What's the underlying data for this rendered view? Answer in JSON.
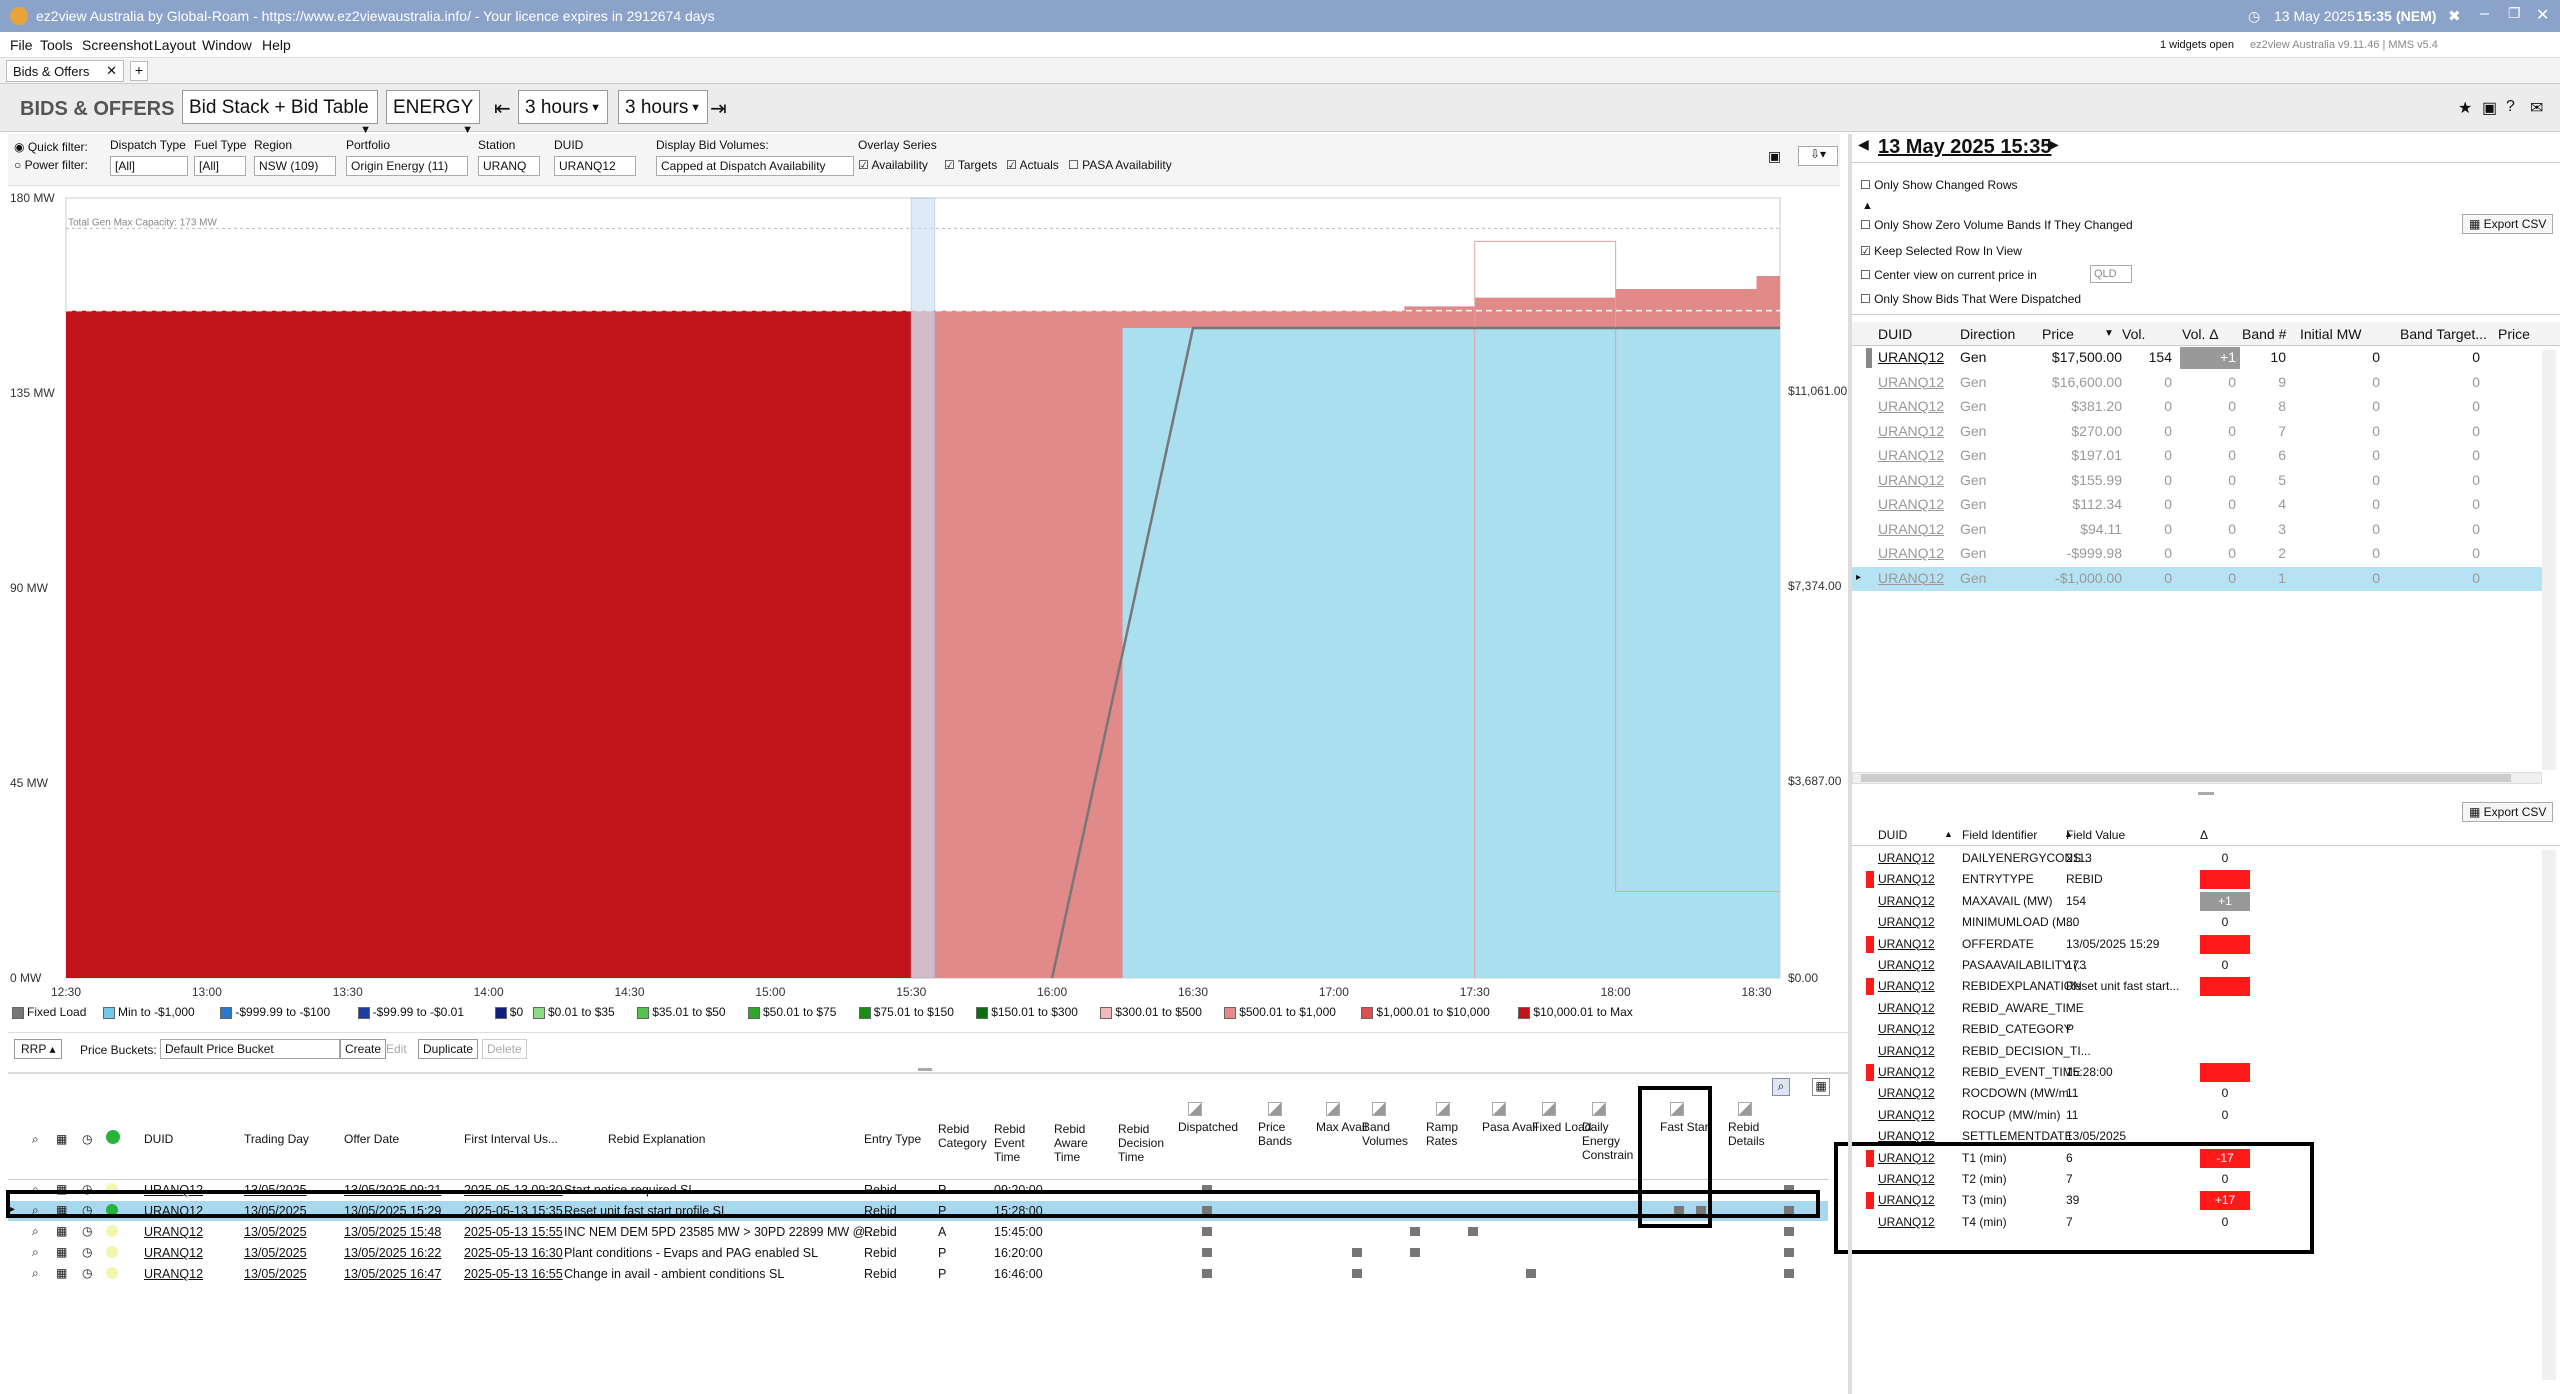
{
  "window": {
    "title": "ez2view Australia by Global-Roam - https://www.ez2viewaustralia.info/ - Your licence expires in 2912674 days",
    "datetime": "13 May 2025",
    "time": "15:35",
    "tz": "(NEM)"
  },
  "menu": [
    "File",
    "Tools",
    "Screenshot",
    "Layout",
    "Window",
    "Help"
  ],
  "menu_right": {
    "widgets": "1 widgets open",
    "version": "ez2view Australia v9.11.46 | MMS v5.4"
  },
  "tab": {
    "label": "Bids & Offers"
  },
  "header": {
    "title": "BIDS & OFFERS",
    "view": "Bid Stack + Bid Table",
    "market": "ENERGY",
    "back": "3 hours",
    "fwd": "3 hours"
  },
  "filters": {
    "quick": "Quick filter:",
    "power": "Power filter:",
    "dispatch_type_label": "Dispatch Type",
    "dispatch_type": "[All]",
    "fuel_type_label": "Fuel Type",
    "fuel_type": "[All]",
    "region_label": "Region",
    "region": "NSW (109)",
    "portfolio_label": "Portfolio",
    "portfolio": "Origin Energy (11)",
    "station_label": "Station",
    "station": "URANQ",
    "duid_label": "DUID",
    "duid": "URANQ12",
    "display_label": "Display Bid Volumes:",
    "display": "Capped at Dispatch Availability",
    "overlay_label": "Overlay Series",
    "availability": "Availability",
    "targets": "Targets",
    "actuals": "Actuals",
    "pasa": "PASA Availability"
  },
  "chart_data": {
    "type": "area",
    "title": "",
    "xlabel": "",
    "ylabel": "",
    "ylim": [
      0,
      180
    ],
    "y_ticks": [
      "0 MW",
      "45 MW",
      "90 MW",
      "135 MW",
      "180 MW"
    ],
    "x_ticks": [
      "12:30",
      "13:00",
      "13:30",
      "14:00",
      "14:30",
      "15:00",
      "15:30",
      "16:00",
      "16:30",
      "17:00",
      "17:30",
      "18:00",
      "18:30"
    ],
    "y2_ticks": [
      "$0.00",
      "$3,687.00",
      "$7,374.00",
      "$11,061.00"
    ],
    "annotation": "Total Gen Max Capacity: 173 MW",
    "series": [
      {
        "name": "$10,000.01 to Max",
        "color": "#c0141a",
        "x": [
          "12:30",
          "15:30"
        ],
        "values": [
          154,
          154
        ]
      },
      {
        "name": "$500.01 to $1,000",
        "color": "#e08a8a",
        "x": [
          "15:30",
          "18:35"
        ],
        "values": [
          154,
          162
        ]
      },
      {
        "name": "Min to -$1,000",
        "color": "#aadff0",
        "x": [
          "16:15",
          "18:35"
        ],
        "values": [
          150,
          150
        ]
      }
    ],
    "target_line": {
      "x": [
        "16:00",
        "16:30",
        "18:35"
      ],
      "values": [
        0,
        150,
        150
      ]
    }
  },
  "legend": [
    {
      "label": "Fixed Load",
      "color": "#777777"
    },
    {
      "label": "Min to -$1,000",
      "color": "#74c7e8"
    },
    {
      "label": "-$999.99 to -$100",
      "color": "#2a78c8"
    },
    {
      "label": "-$99.99 to -$0.01",
      "color": "#1b3fa0"
    },
    {
      "label": "$0",
      "color": "#10207a"
    },
    {
      "label": "$0.01 to $35",
      "color": "#8fd88a"
    },
    {
      "label": "$35.01 to $50",
      "color": "#56c24e"
    },
    {
      "label": "$50.01 to $75",
      "color": "#2fa82a"
    },
    {
      "label": "$75.01 to $150",
      "color": "#1a8c18"
    },
    {
      "label": "$150.01 to $300",
      "color": "#0e6d0e"
    },
    {
      "label": "$300.01 to $500",
      "color": "#f3b8b8"
    },
    {
      "label": "$500.01 to $1,000",
      "color": "#e58b8b"
    },
    {
      "label": "$1,000.01 to $10,000",
      "color": "#d95050"
    },
    {
      "label": "$10,000.01 to Max",
      "color": "#c0141a"
    }
  ],
  "chart_toolbar": {
    "rrp": "RRP",
    "buckets_label": "Price Buckets:",
    "bucket": "Default Price Bucket",
    "create": "Create",
    "edit": "Edit",
    "duplicate": "Duplicate",
    "delete": "Delete"
  },
  "bottom_table": {
    "headers": [
      "DUID",
      "Trading Day",
      "Offer Date",
      "First Interval Us...",
      "Rebid Explanation",
      "Entry Type",
      "Rebid Category",
      "Rebid Event Time",
      "Rebid Aware Time",
      "Rebid Decision Time",
      "Dispatched",
      "Price Bands",
      "Max Avail",
      "Band Volumes",
      "Ramp Rates",
      "Pasa Avail",
      "Fixed Load",
      "Daily Energy Constrain",
      "Fast Start",
      "Rebid Details"
    ],
    "rows": [
      {
        "duid": "URANQ12",
        "day": "13/05/2025",
        "offer": "13/05/2025 09:21",
        "first": "2025-05-13 09:30",
        "expl": "Start notice required SL",
        "entry": "Rebid",
        "cat": "P",
        "event": "09:20:00"
      },
      {
        "duid": "URANQ12",
        "day": "13/05/2025",
        "offer": "13/05/2025 15:29",
        "first": "2025-05-13 15:35",
        "expl": "Reset unit fast start profile SL",
        "entry": "Rebid",
        "cat": "P",
        "event": "15:28:00"
      },
      {
        "duid": "URANQ12",
        "day": "13/05/2025",
        "offer": "13/05/2025 15:48",
        "first": "2025-05-13 15:55",
        "expl": "INC NEM DEM 5PD 23585 MW > 30PD 22899 MW @...",
        "entry": "Rebid",
        "cat": "A",
        "event": "15:45:00"
      },
      {
        "duid": "URANQ12",
        "day": "13/05/2025",
        "offer": "13/05/2025 16:22",
        "first": "2025-05-13 16:30",
        "expl": "Plant conditions - Evaps and PAG enabled SL",
        "entry": "Rebid",
        "cat": "P",
        "event": "16:20:00"
      },
      {
        "duid": "URANQ12",
        "day": "13/05/2025",
        "offer": "13/05/2025 16:47",
        "first": "2025-05-13 16:55",
        "expl": "Change in avail - ambient conditions SL",
        "entry": "Rebid",
        "cat": "P",
        "event": "16:46:00"
      }
    ]
  },
  "right": {
    "date": "13 May 2025 15:35",
    "only_changed": "Only Show Changed Rows",
    "only_zero": "Only Show Zero Volume Bands If They Changed",
    "keep_selected": "Keep Selected Row In View",
    "center_view": "Center view on current price in",
    "center_region": "QLD",
    "only_dispatched": "Only Show Bids That Were Dispatched",
    "export": "Export CSV",
    "band_headers": [
      "DUID",
      "Direction",
      "Price",
      "Vol.",
      "Vol. Δ",
      "Band #",
      "Initial MW",
      "Band Target...",
      "Price"
    ],
    "bands": [
      {
        "duid": "URANQ12",
        "dir": "Gen",
        "price": "$17,500.00",
        "vol": "154",
        "dvol": "+1",
        "band": "10",
        "init": "0",
        "target": "0"
      },
      {
        "duid": "URANQ12",
        "dir": "Gen",
        "price": "$16,600.00",
        "vol": "0",
        "dvol": "0",
        "band": "9",
        "init": "0",
        "target": "0"
      },
      {
        "duid": "URANQ12",
        "dir": "Gen",
        "price": "$381.20",
        "vol": "0",
        "dvol": "0",
        "band": "8",
        "init": "0",
        "target": "0"
      },
      {
        "duid": "URANQ12",
        "dir": "Gen",
        "price": "$270.00",
        "vol": "0",
        "dvol": "0",
        "band": "7",
        "init": "0",
        "target": "0"
      },
      {
        "duid": "URANQ12",
        "dir": "Gen",
        "price": "$197.01",
        "vol": "0",
        "dvol": "0",
        "band": "6",
        "init": "0",
        "target": "0"
      },
      {
        "duid": "URANQ12",
        "dir": "Gen",
        "price": "$155.99",
        "vol": "0",
        "dvol": "0",
        "band": "5",
        "init": "0",
        "target": "0"
      },
      {
        "duid": "URANQ12",
        "dir": "Gen",
        "price": "$112.34",
        "vol": "0",
        "dvol": "0",
        "band": "4",
        "init": "0",
        "target": "0"
      },
      {
        "duid": "URANQ12",
        "dir": "Gen",
        "price": "$94.11",
        "vol": "0",
        "dvol": "0",
        "band": "3",
        "init": "0",
        "target": "0"
      },
      {
        "duid": "URANQ12",
        "dir": "Gen",
        "price": "-$999.98",
        "vol": "0",
        "dvol": "0",
        "band": "2",
        "init": "0",
        "target": "0"
      },
      {
        "duid": "URANQ12",
        "dir": "Gen",
        "price": "-$1,000.00",
        "vol": "0",
        "dvol": "0",
        "band": "1",
        "init": "0",
        "target": "0"
      }
    ],
    "field_headers": [
      "DUID",
      "Field Identifier",
      "Field Value",
      "Δ"
    ],
    "fields": [
      {
        "duid": "URANQ12",
        "id": "DAILYENERGYCONS...",
        "val": "2113",
        "d": "0",
        "flag": false,
        "dc": "none"
      },
      {
        "duid": "URANQ12",
        "id": "ENTRYTYPE",
        "val": "REBID",
        "d": "",
        "flag": true,
        "dc": "red"
      },
      {
        "duid": "URANQ12",
        "id": "MAXAVAIL (MW)",
        "val": "154",
        "d": "+1",
        "flag": false,
        "dc": "gray"
      },
      {
        "duid": "URANQ12",
        "id": "MINIMUMLOAD (M...",
        "val": "80",
        "d": "0",
        "flag": false,
        "dc": "none"
      },
      {
        "duid": "URANQ12",
        "id": "OFFERDATE",
        "val": "13/05/2025 15:29",
        "d": "",
        "flag": true,
        "dc": "red"
      },
      {
        "duid": "URANQ12",
        "id": "PASAAVAILABILITY (...",
        "val": "173",
        "d": "0",
        "flag": false,
        "dc": "none"
      },
      {
        "duid": "URANQ12",
        "id": "REBIDEXPLANATION",
        "val": "Reset unit fast start...",
        "d": "",
        "flag": true,
        "dc": "red"
      },
      {
        "duid": "URANQ12",
        "id": "REBID_AWARE_TIME",
        "val": "",
        "d": "",
        "flag": false,
        "dc": "none"
      },
      {
        "duid": "URANQ12",
        "id": "REBID_CATEGORY",
        "val": "P",
        "d": "",
        "flag": false,
        "dc": "none"
      },
      {
        "duid": "URANQ12",
        "id": "REBID_DECISION_TI...",
        "val": "",
        "d": "",
        "flag": false,
        "dc": "none"
      },
      {
        "duid": "URANQ12",
        "id": "REBID_EVENT_TIME",
        "val": "15:28:00",
        "d": "",
        "flag": true,
        "dc": "red"
      },
      {
        "duid": "URANQ12",
        "id": "ROCDOWN (MW/m...",
        "val": "11",
        "d": "0",
        "flag": false,
        "dc": "none"
      },
      {
        "duid": "URANQ12",
        "id": "ROCUP (MW/min)",
        "val": "11",
        "d": "0",
        "flag": false,
        "dc": "none"
      },
      {
        "duid": "URANQ12",
        "id": "SETTLEMENTDATE",
        "val": "13/05/2025",
        "d": "",
        "flag": false,
        "dc": "none"
      },
      {
        "duid": "URANQ12",
        "id": "T1 (min)",
        "val": "6",
        "d": "-17",
        "flag": true,
        "dc": "red"
      },
      {
        "duid": "URANQ12",
        "id": "T2 (min)",
        "val": "7",
        "d": "0",
        "flag": false,
        "dc": "none"
      },
      {
        "duid": "URANQ12",
        "id": "T3 (min)",
        "val": "39",
        "d": "+17",
        "flag": true,
        "dc": "red"
      },
      {
        "duid": "URANQ12",
        "id": "T4 (min)",
        "val": "7",
        "d": "0",
        "flag": false,
        "dc": "none"
      }
    ]
  }
}
